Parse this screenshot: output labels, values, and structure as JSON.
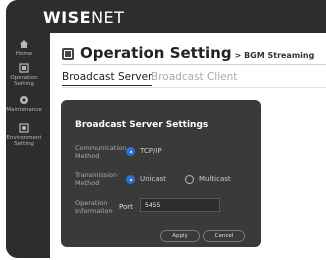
{
  "brand": {
    "logo_bold": "WISE",
    "logo_light": "NET"
  },
  "sidebar": {
    "items": [
      {
        "label": "Home"
      },
      {
        "label": "Operation Setting"
      },
      {
        "label": "Maintenance"
      },
      {
        "label": "Environment Setting"
      }
    ]
  },
  "page": {
    "title": "Operation Setting",
    "subtitle": "> BGM Streaming",
    "tabs": [
      {
        "label": "Broadcast Server",
        "active": true
      },
      {
        "label": "Broadcast Client",
        "active": false
      }
    ]
  },
  "panel": {
    "title": "Broadcast Server Settings",
    "communication_label": "Communication Method",
    "communication_option": "TCP/IP",
    "transmission_label": "Transmission Method",
    "transmission_options": [
      "Unicast",
      "Multicast"
    ],
    "operation_label": "Operation Information",
    "port_label": "Port",
    "port_value": "5455",
    "apply_label": "Apply",
    "cancel_label": "Cancel"
  },
  "colors": {
    "accent": "#2f6fd6",
    "sidebar_bg": "#2d2d2d",
    "panel_bg": "#3a3a3a"
  }
}
